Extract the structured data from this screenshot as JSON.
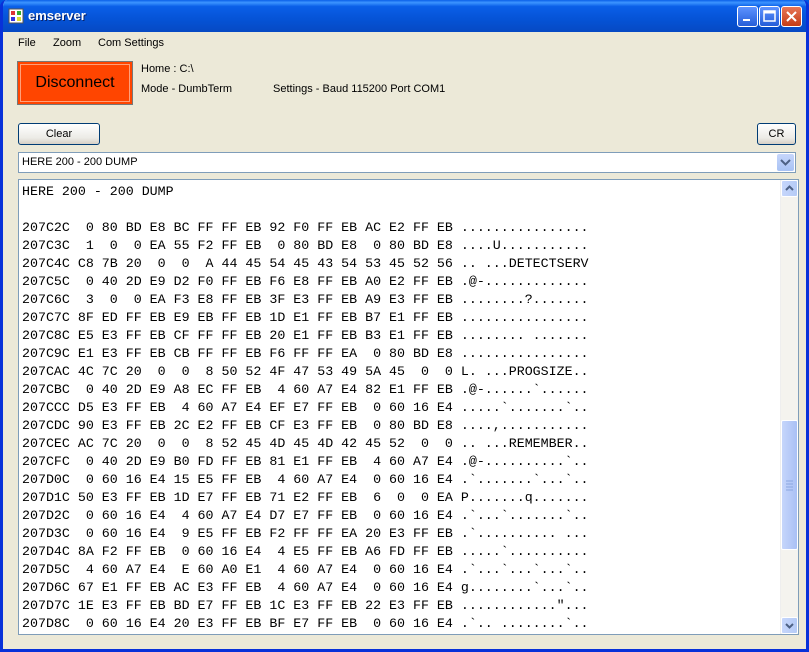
{
  "window": {
    "title": "emserver"
  },
  "menu": {
    "items": [
      "File",
      "Zoom",
      "Com Settings"
    ]
  },
  "controls": {
    "disconnect_label": "Disconnect",
    "home": "Home :  C:\\",
    "mode": "Mode - DumbTerm",
    "settings": "Settings - Baud 115200 Port COM1",
    "clear_label": "Clear",
    "cr_label": "CR"
  },
  "command_combo": {
    "value": "HERE 200 - 200 DUMP"
  },
  "terminal": {
    "header": "HERE 200 - 200 DUMP",
    "lines": [
      "",
      "207C2C  0 80 BD E8 BC FF FF EB 92 F0 FF EB AC E2 FF EB ................",
      "207C3C  1  0  0 EA 55 F2 FF EB  0 80 BD E8  0 80 BD E8 ....U...........",
      "207C4C C8 7B 20  0  0  A 44 45 54 45 43 54 53 45 52 56 .. ...DETECTSERV",
      "207C5C  0 40 2D E9 D2 F0 FF EB F6 E8 FF EB A0 E2 FF EB .@-.............",
      "207C6C  3  0  0 EA F3 E8 FF EB 3F E3 FF EB A9 E3 FF EB ........?.......",
      "207C7C 8F ED FF EB E9 EB FF EB 1D E1 FF EB B7 E1 FF EB ................",
      "207C8C E5 E3 FF EB CF FF FF EB 20 E1 FF EB B3 E1 FF EB ........ .......",
      "207C9C E1 E3 FF EB CB FF FF EB F6 FF FF EA  0 80 BD E8 ................",
      "207CAC 4C 7C 20  0  0  8 50 52 4F 47 53 49 5A 45  0  0 L. ...PROGSIZE..",
      "207CBC  0 40 2D E9 A8 EC FF EB  4 60 A7 E4 82 E1 FF EB .@-......`......",
      "207CCC D5 E3 FF EB  4 60 A7 E4 EF E7 FF EB  0 60 16 E4 .....`.......`..",
      "207CDC 90 E3 FF EB 2C E2 FF EB CF E3 FF EB  0 80 BD E8 ....,...........",
      "207CEC AC 7C 20  0  0  8 52 45 4D 45 4D 42 45 52  0  0 .. ...REMEMBER..",
      "207CFC  0 40 2D E9 B0 FD FF EB 81 E1 FF EB  4 60 A7 E4 .@-..........`..",
      "207D0C  0 60 16 E4 15 E5 FF EB  4 60 A7 E4  0 60 16 E4 .`.......`...`..",
      "207D1C 50 E3 FF EB 1D E7 FF EB 71 E2 FF EB  6  0  0 EA P.......q.......",
      "207D2C  0 60 16 E4  4 60 A7 E4 D7 E7 FF EB  0 60 16 E4 .`...`.......`..",
      "207D3C  0 60 16 E4  9 E5 FF EB F2 FF FF EA 20 E3 FF EB .`.......... ...",
      "207D4C 8A F2 FF EB  0 60 16 E4  4 E5 FF EB A6 FD FF EB .....`..........",
      "207D5C  4 60 A7 E4  E 60 A0 E1  4 60 A7 E4  0 60 16 E4 .`...`...`...`..",
      "207D6C 67 E1 FF EB AC E3 FF EB  4 60 A7 E4  0 60 16 E4 g........`...`..",
      "207D7C 1E E3 FF EB BD E7 FF EB 1C E3 FF EB 22 E3 FF EB ............\"...",
      "207D8C  0 60 16 E4 20 E3 FF EB BF E7 FF EB  0 60 16 E4 .`.. ........`.."
    ]
  },
  "colors": {
    "disconnect_bg": "#ff4500",
    "titlebar": "#0a5fe8",
    "window_bg": "#ece9d8"
  }
}
